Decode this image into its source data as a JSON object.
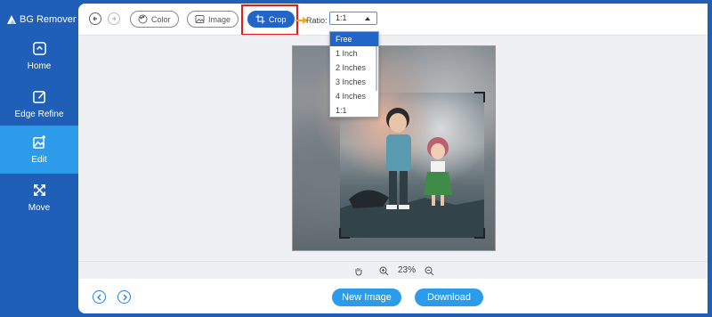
{
  "app": {
    "title": "BG Remover"
  },
  "sidebar": {
    "items": [
      {
        "label": "Home",
        "icon": "home-icon"
      },
      {
        "label": "Edge Refine",
        "icon": "edit-pen-icon"
      },
      {
        "label": "Edit",
        "icon": "image-edit-icon",
        "active": true
      },
      {
        "label": "Move",
        "icon": "move-arrows-icon"
      }
    ]
  },
  "toolbar": {
    "color_label": "Color",
    "image_label": "Image",
    "crop_label": "Crop",
    "ratio_label": "Ratio:",
    "ratio_value": "1:1"
  },
  "ratio_options": [
    "Free",
    "1 Inch",
    "2 Inches",
    "3 Inches",
    "4 Inches",
    "1:1"
  ],
  "zoom": {
    "level": "23%"
  },
  "footer": {
    "new_image_label": "New Image",
    "download_label": "Download"
  },
  "colors": {
    "sidebar": "#1F5FB8",
    "active_nav": "#2C9BEA",
    "accent": "#2265C8",
    "highlight_box": "#E31B1B"
  }
}
